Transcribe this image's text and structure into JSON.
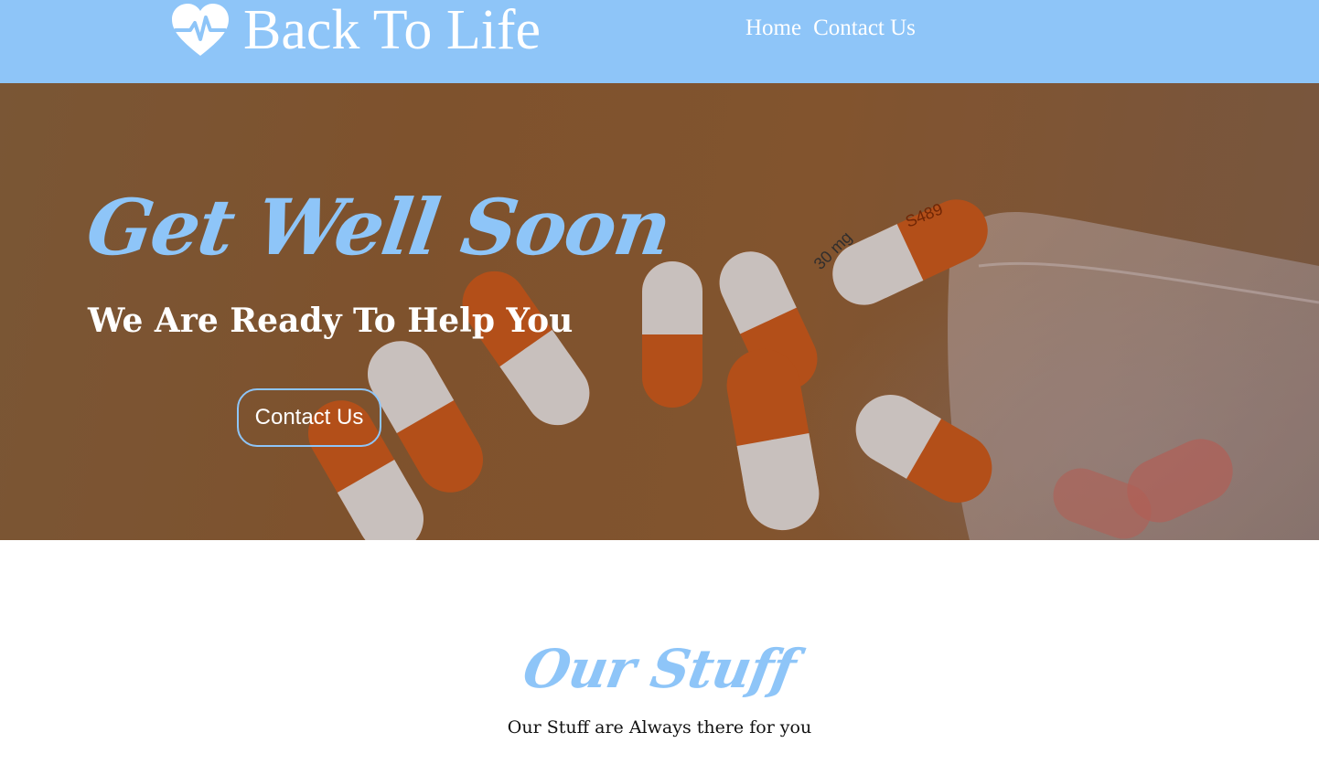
{
  "header": {
    "brand": "Back To Life",
    "brand_icon": "heart-pulse-icon",
    "background": "#8ec5f8",
    "nav": [
      {
        "label": "Home"
      },
      {
        "label": "Contact Us"
      }
    ]
  },
  "hero": {
    "title": "Get Well Soon",
    "subtitle": "We Are Ready To Help You",
    "button_label": "Contact Us",
    "background_image": "orange-and-white-capsules-spilled-from-bag",
    "capsule_label": "30 mg",
    "capsule_code": "S489",
    "accent_color": "#8ec5f8"
  },
  "staff_section": {
    "title": "Our Stuff",
    "subtitle": "Our Stuff are Always there for you"
  }
}
